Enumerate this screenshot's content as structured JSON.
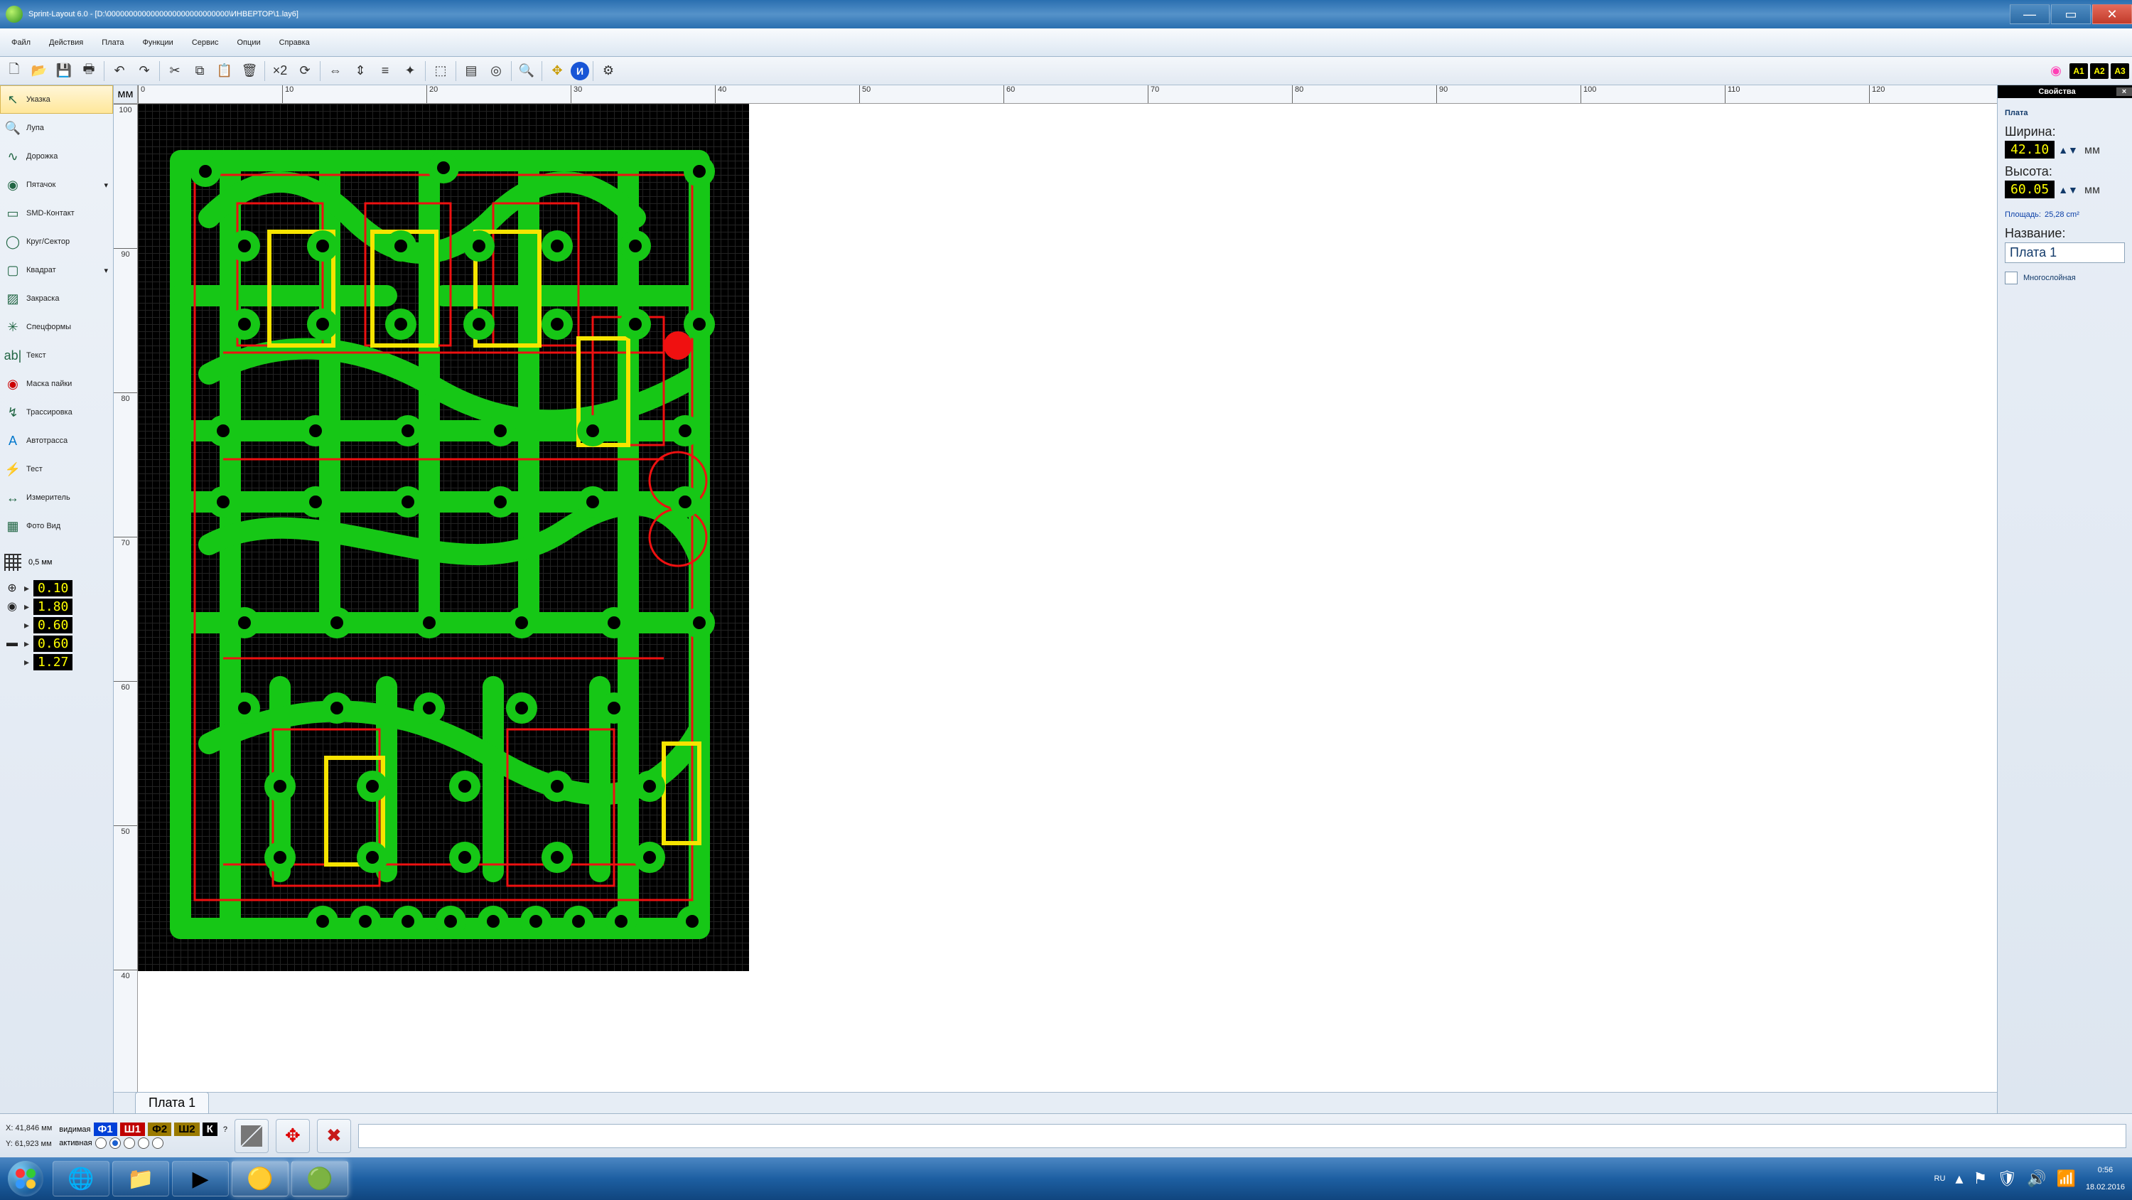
{
  "title": "Sprint-Layout 6.0 - [D:\\0000000000000000000000000000\\ИНВЕРТОР\\1.lay6]",
  "menu": [
    "Файл",
    "Действия",
    "Плата",
    "Функции",
    "Сервис",
    "Опции",
    "Справка"
  ],
  "tools": [
    {
      "label": "Указка",
      "icon": "↖",
      "sel": true
    },
    {
      "label": "Лупа",
      "icon": "🔍"
    },
    {
      "label": "Дорожка",
      "icon": "∿"
    },
    {
      "label": "Пятачок",
      "icon": "◉",
      "drop": true
    },
    {
      "label": "SMD-Контакт",
      "icon": "▭"
    },
    {
      "label": "Круг/Сектор",
      "icon": "◯"
    },
    {
      "label": "Квадрат",
      "icon": "▢",
      "drop": true
    },
    {
      "label": "Закраска",
      "icon": "▨"
    },
    {
      "label": "Спецформы",
      "icon": "✳"
    },
    {
      "label": "Текст",
      "icon": "ab|"
    },
    {
      "label": "Маска пайки",
      "icon": "◉",
      "red": true
    },
    {
      "label": "Трассировка",
      "icon": "↯"
    },
    {
      "label": "Автотрасса",
      "icon": "A",
      "blue": true
    },
    {
      "label": "Тест",
      "icon": "⚡"
    },
    {
      "label": "Измеритель",
      "icon": "↔"
    },
    {
      "label": "Фото Вид",
      "icon": "▦"
    }
  ],
  "grid": "0,5 мм",
  "params": [
    {
      "icon": "⊕",
      "vals": [
        "0.10"
      ]
    },
    {
      "icon": "◉",
      "vals": [
        "1.80",
        "0.60"
      ]
    },
    {
      "icon": "▬",
      "vals": [
        "0.60",
        "1.27"
      ]
    }
  ],
  "ruler_unit": "мм",
  "rulerH": [
    0,
    10,
    20,
    30,
    40,
    50,
    60,
    70,
    80,
    90,
    100,
    110,
    120
  ],
  "rulerV": [
    100,
    90,
    80,
    70,
    60,
    50,
    40
  ],
  "tab": "Плата 1",
  "right": {
    "title": "Свойства",
    "section": "Плата",
    "width_label": "Ширина:",
    "width": "42.10",
    "height_label": "Высота:",
    "height": "60.05",
    "unit": "мм",
    "area_label": "Площадь:",
    "area": "25,28 cm²",
    "name_label": "Название:",
    "name": "Плата 1",
    "multilayer": "Многослойная"
  },
  "status": {
    "x_label": "X:",
    "x": "41,846 мм",
    "y_label": "Y:",
    "y": "61,923 мм",
    "vis": "видимая",
    "act": "активная",
    "chips": [
      "Ф1",
      "Ш1",
      "Ф2",
      "Ш2",
      "К"
    ]
  },
  "toolbar_rt": [
    "А1",
    "А2",
    "А3"
  ],
  "taskbar": {
    "lang": "RU",
    "time": "0:56",
    "date": "18.02.2016"
  }
}
